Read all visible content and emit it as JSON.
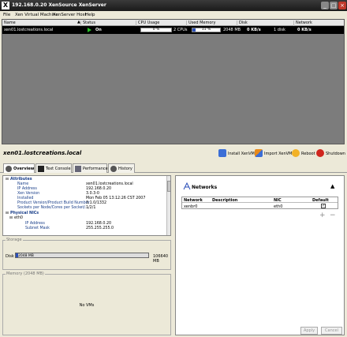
{
  "window": {
    "title": "192.168.0.20 XenSource XenServer"
  },
  "menu": [
    "File",
    "Xen Virtual Machine",
    "XenServer Host",
    "Help"
  ],
  "vm_list": {
    "columns": [
      "Name",
      "Status",
      "CPU Usage",
      "Used Memory",
      "Disk",
      "Network"
    ],
    "rows": [
      {
        "name": "xen01.lostcreations.local",
        "status": "On",
        "cpu_pct": "0 %",
        "cpu_count": "2 CPUs",
        "mem_pct": "11 %",
        "mem_total": "2048 MB",
        "disk_rate": "0 KB/s",
        "disk_count": "1 disk",
        "net_rate": "0 KB/s",
        "cpu_fraction": 0.0,
        "mem_fraction": 0.11
      }
    ]
  },
  "selected_host": "xen01.lostcreations.local",
  "actions": [
    "Install XenVM",
    "Import XenVM",
    "Reboot",
    "Shutdown"
  ],
  "tabs": [
    "Overview",
    "Text Console",
    "Performance",
    "History"
  ],
  "attributes": [
    {
      "type": "section",
      "label": "Attributes"
    },
    {
      "key": "Name",
      "value": "xen01.lostcreations.local"
    },
    {
      "key": "IP Address",
      "value": "192.168.0.20"
    },
    {
      "key": "Xen Version",
      "value": "3.0.3-0"
    },
    {
      "key": "Installed",
      "value": "Mon Feb 05 13:12:26 CST 2007"
    },
    {
      "key": "Product Version/Product Build Number",
      "value": "3.1.0/1332"
    },
    {
      "key": "Sockets per Node/Cores per Socket/...",
      "value": "1/2/1"
    },
    {
      "type": "section",
      "label": "Physical NICs"
    },
    {
      "type": "sub",
      "label": "eth0"
    },
    {
      "key": "IP Address",
      "value": "192.168.0.20"
    },
    {
      "key": "Subnet Mask",
      "value": "255.255.255.0"
    }
  ],
  "storage": {
    "title": "Storage",
    "disk_label": "Disk",
    "used": "2048 MB",
    "total": "106640 MB",
    "used_fraction": 0.019
  },
  "memory": {
    "title": "Memory (2048 MB)",
    "empty_text": "No VMs"
  },
  "networks": {
    "title": "Networks",
    "columns": [
      "Network",
      "Description",
      "NIC",
      "Default"
    ],
    "rows": [
      {
        "network": "xenbr0",
        "description": "",
        "nic": "eth0",
        "default": true
      }
    ],
    "add": "+",
    "remove": "−",
    "apply": "Apply",
    "cancel": "Cancel"
  },
  "colors": {
    "accent": "#2b4fb8",
    "on": "#28c028",
    "titlebar": "#1a1a1a"
  }
}
